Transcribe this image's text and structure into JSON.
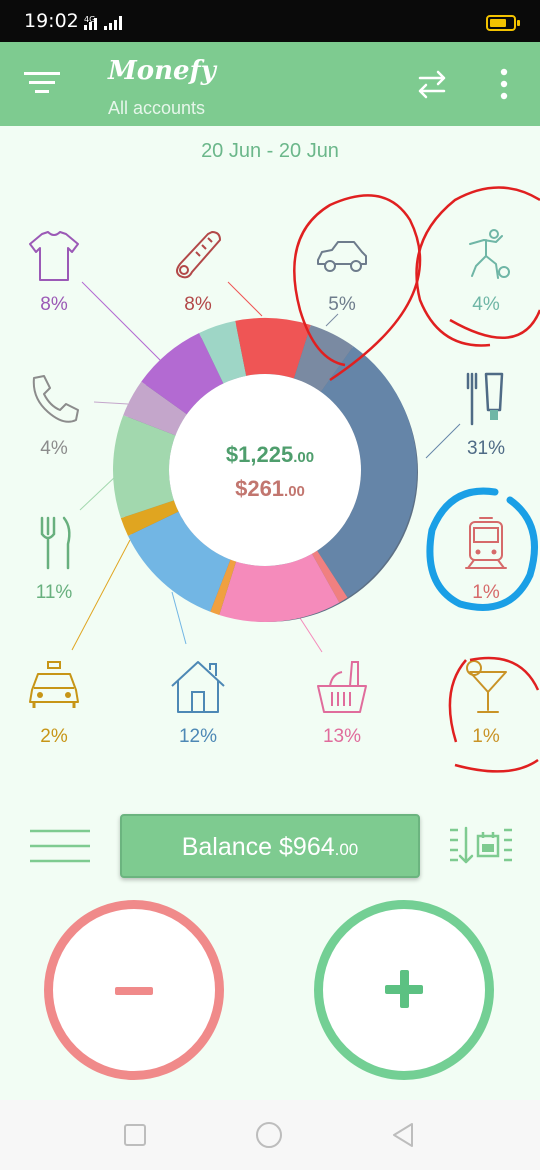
{
  "status_bar": {
    "time": "19:02",
    "network": "4G"
  },
  "app_bar": {
    "title": "Monefy",
    "subtitle": "All accounts"
  },
  "date_range": "20 Jun - 20 Jun",
  "categories": [
    {
      "id": "clothes",
      "icon": "tshirt-icon",
      "percent": "8%",
      "color": "#9b59b6"
    },
    {
      "id": "health",
      "icon": "thermometer-icon",
      "percent": "8%",
      "color": "#b24848"
    },
    {
      "id": "car",
      "icon": "car-icon",
      "percent": "5%",
      "color": "#6e7c8c"
    },
    {
      "id": "sports",
      "icon": "soccer-player-icon",
      "percent": "4%",
      "color": "#6fb6a6"
    },
    {
      "id": "communications",
      "icon": "phone-icon",
      "percent": "4%",
      "color": "#8c8c8c"
    },
    {
      "id": "toiletry",
      "icon": "toothbrush-toothpaste-icon",
      "percent": "31%",
      "color": "#4f6b86"
    },
    {
      "id": "eating-out",
      "icon": "fork-knife-icon",
      "percent": "11%",
      "color": "#68b07e"
    },
    {
      "id": "transport",
      "icon": "train-icon",
      "percent": "1%",
      "color": "#d66a6a"
    },
    {
      "id": "taxi",
      "icon": "taxi-icon",
      "percent": "2%",
      "color": "#c79516"
    },
    {
      "id": "house",
      "icon": "house-icon",
      "percent": "12%",
      "color": "#4d88b5"
    },
    {
      "id": "food",
      "icon": "grocery-basket-icon",
      "percent": "13%",
      "color": "#e06c9c"
    },
    {
      "id": "entertainment",
      "icon": "cocktail-icon",
      "percent": "1%",
      "color": "#c99326"
    }
  ],
  "chart_data": {
    "type": "pie",
    "slices": [
      {
        "category": "toiletry",
        "percent": 31,
        "color": "#6585a8"
      },
      {
        "category": "transport",
        "percent": 1,
        "color": "#f08080"
      },
      {
        "category": "food",
        "percent": 13,
        "color": "#f58bbb"
      },
      {
        "category": "entertainment",
        "percent": 1,
        "color": "#f0a040"
      },
      {
        "category": "house",
        "percent": 12,
        "color": "#72b6e4"
      },
      {
        "category": "taxi",
        "percent": 2,
        "color": "#e0a520"
      },
      {
        "category": "eating-out",
        "percent": 11,
        "color": "#a2d8ae"
      },
      {
        "category": "communications",
        "percent": 4,
        "color": "#c4a6cb"
      },
      {
        "category": "clothes",
        "percent": 8,
        "color": "#b36ad2"
      },
      {
        "category": "sports",
        "percent": 4,
        "color": "#9ed6c6"
      },
      {
        "category": "health",
        "percent": 8,
        "color": "#ef5555"
      },
      {
        "category": "car",
        "percent": 5,
        "color": "#7a8aa2"
      }
    ]
  },
  "totals": {
    "income": "$1,225",
    "income_cents": ".00",
    "expense": "$261",
    "expense_cents": ".00"
  },
  "balance": {
    "label": "Balance $964",
    "cents": ".00"
  },
  "colors": {
    "accent": "#7ecb90",
    "income": "#4f9e6d",
    "expense": "#c2766f",
    "minus": "#f08a8a",
    "plus": "#5cc182"
  }
}
